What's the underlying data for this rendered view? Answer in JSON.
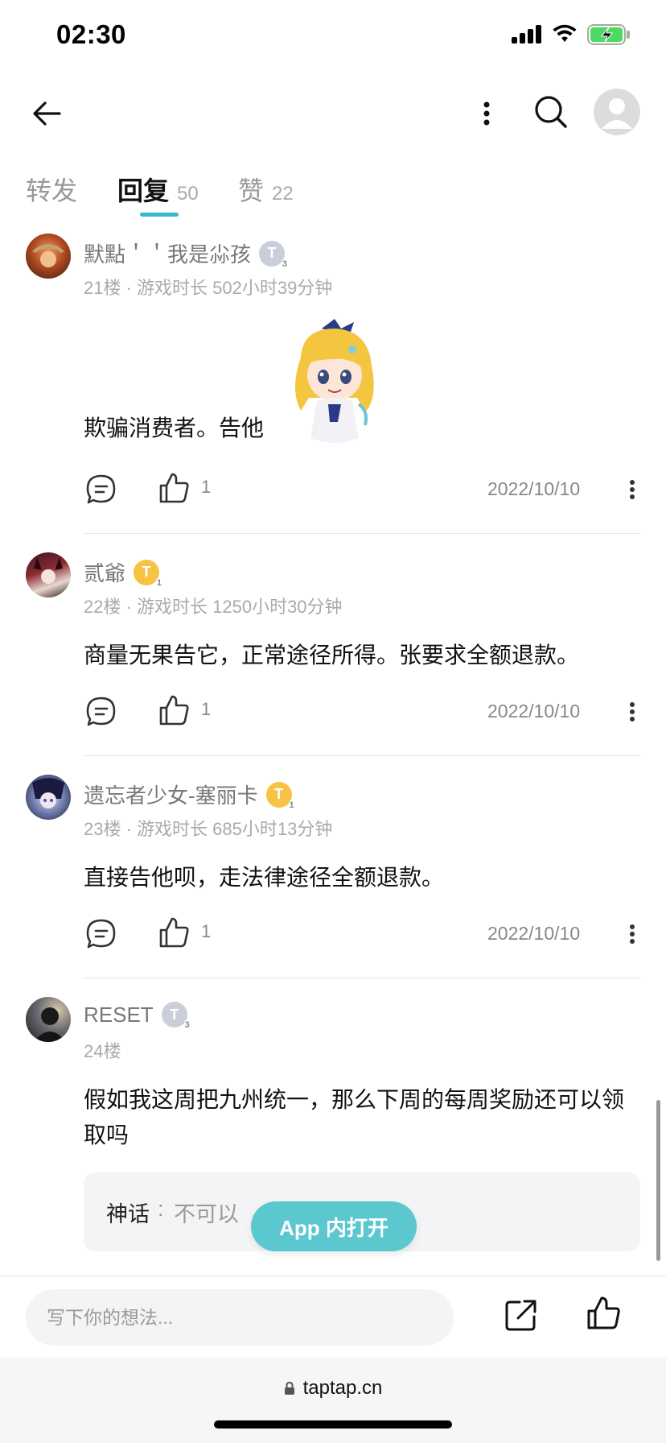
{
  "status_bar": {
    "time": "02:30"
  },
  "tabs": [
    {
      "label": "转发",
      "count": ""
    },
    {
      "label": "回复",
      "count": "50"
    },
    {
      "label": "赞",
      "count": "22"
    }
  ],
  "comments": [
    {
      "name": "默點＇＇我是尛孩",
      "badge": "T",
      "badge_level": "3",
      "badge_color": "silver",
      "meta": "21楼 · 游戏时长 502小时39分钟",
      "text": "欺骗消费者。告他",
      "likes": "1",
      "date": "2022/10/10"
    },
    {
      "name": "贰爺",
      "badge": "T",
      "badge_level": "1",
      "badge_color": "gold",
      "meta": "22楼 · 游戏时长 1250小时30分钟",
      "text": "商量无果告它，正常途径所得。张要求全额退款。",
      "likes": "1",
      "date": "2022/10/10"
    },
    {
      "name": "遗忘者少女-塞丽卡",
      "badge": "T",
      "badge_level": "1",
      "badge_color": "gold",
      "meta": "23楼 · 游戏时长 685小时13分钟",
      "text": "直接告他呗，走法律途径全额退款。",
      "likes": "1",
      "date": "2022/10/10"
    },
    {
      "name": "RESET",
      "badge": "T",
      "badge_level": "3",
      "badge_color": "silver",
      "meta": "24楼",
      "text": "假如我这周把九州统一，那么下周的每周奖励还可以领取吗"
    }
  ],
  "sub_reply": {
    "name": "神话",
    "separator": ":",
    "text": "不可以"
  },
  "open_app_button": "App 内打开",
  "compose": {
    "placeholder": "写下你的想法..."
  },
  "browser": {
    "url": "taptap.cn"
  },
  "colors": {
    "accent": "#35b9c8",
    "open_app": "#5bc7ce",
    "badge_gold": "#f6c343",
    "badge_silver": "#c9ced8"
  },
  "icons": [
    "back-arrow-icon",
    "more-vertical-icon",
    "search-icon",
    "user-avatar-icon",
    "reply-icon",
    "thumb-up-icon",
    "share-icon",
    "lock-icon",
    "battery-charging-icon",
    "wifi-icon",
    "signal-icon"
  ]
}
